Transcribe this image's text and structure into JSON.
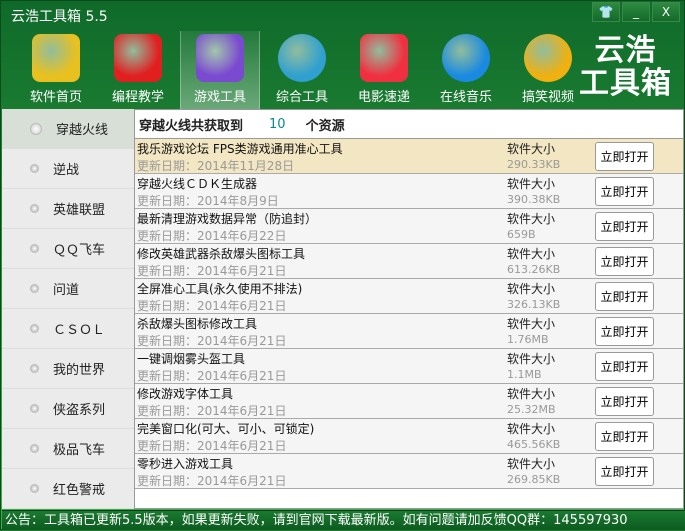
{
  "window": {
    "title": "云浩工具箱 5.5",
    "skin": "👕",
    "minimize": "_",
    "close": "X"
  },
  "toolbar": [
    {
      "label": "软件首页",
      "icon": "home-icon",
      "color": "#e8c020"
    },
    {
      "label": "编程教学",
      "icon": "programming-icon",
      "color": "#e02020"
    },
    {
      "label": "游戏工具",
      "icon": "gamepad-icon",
      "color": "#7a4ad0",
      "active": true
    },
    {
      "label": "综合工具",
      "icon": "multi-tool-icon",
      "color": "#30a0d0"
    },
    {
      "label": "电影速递",
      "icon": "movie-icon",
      "color": "#f03040"
    },
    {
      "label": "在线音乐",
      "icon": "music-icon",
      "color": "#1a8ae0"
    },
    {
      "label": "搞笑视频",
      "icon": "funny-video-icon",
      "color": "#f0b010"
    }
  ],
  "logo": {
    "line1": "云浩",
    "line2": "工具箱"
  },
  "sidebar": [
    {
      "label": "穿越火线",
      "active": true
    },
    {
      "label": "逆战"
    },
    {
      "label": "英雄联盟"
    },
    {
      "label": "ＱＱ飞车"
    },
    {
      "label": "问道"
    },
    {
      "label": "ＣＳＯＬ"
    },
    {
      "label": "我的世界"
    },
    {
      "label": "侠盗系列"
    },
    {
      "label": "极品飞车"
    },
    {
      "label": "红色警戒"
    }
  ],
  "header": {
    "prefix": "穿越火线共获取到",
    "count": "10",
    "suffix": "个资源"
  },
  "size_label": "软件大小",
  "open_label": "立即打开",
  "items": [
    {
      "name": "我乐游戏论坛 FPS类游戏通用准心工具",
      "date": "更新日期：2014年11月28日",
      "size": "290.33KB"
    },
    {
      "name": "穿越火线ＣＤＫ生成器",
      "date": "更新日期：2014年8月9日",
      "size": "390.38KB"
    },
    {
      "name": "最新清理游戏数据异常（防追封）",
      "date": "更新日期：2014年6月22日",
      "size": "659B"
    },
    {
      "name": "修改英雄武器杀敌爆头图标工具",
      "date": "更新日期：2014年6月21日",
      "size": "613.26KB"
    },
    {
      "name": "全屏准心工具(永久使用不排法)",
      "date": "更新日期：2014年6月21日",
      "size": "326.13KB"
    },
    {
      "name": "杀敌爆头图标修改工具",
      "date": "更新日期：2014年6月21日",
      "size": "1.76MB"
    },
    {
      "name": "一键调烟雾头盔工具",
      "date": "更新日期：2014年6月21日",
      "size": "1.1MB"
    },
    {
      "name": "修改游戏字体工具",
      "date": "更新日期：2014年6月21日",
      "size": "25.32MB"
    },
    {
      "name": "完美窗口化(可大、可小、可锁定)",
      "date": "更新日期：2014年6月21日",
      "size": "465.56KB"
    },
    {
      "name": "零秒进入游戏工具",
      "date": "更新日期：2014年6月21日",
      "size": "269.85KB"
    }
  ],
  "footer": "公告：工具箱已更新5.5版本，如果更新失败，请到官网下载最新版。如有问题请加反馈QQ群：145597930"
}
